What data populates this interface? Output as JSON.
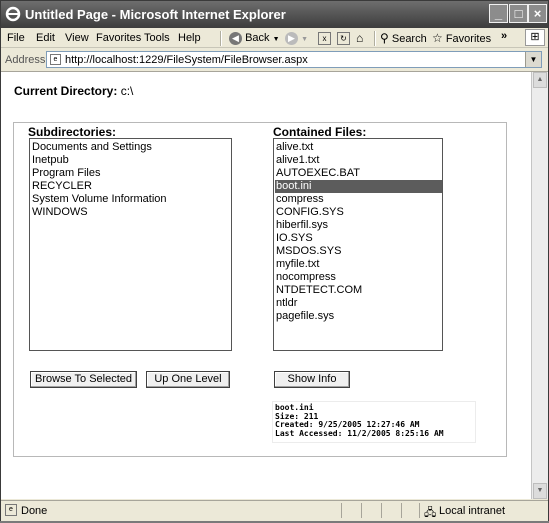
{
  "window": {
    "title": "Untitled Page - Microsoft Internet Explorer"
  },
  "menu": [
    "File",
    "Edit",
    "View",
    "Favorites",
    "Tools",
    "Help"
  ],
  "toolbar": {
    "back_label": "Back",
    "search_label": "Search",
    "favorites_label": "Favorites",
    "chevron": "»"
  },
  "address": {
    "label": "Address",
    "url": "http://localhost:1229/FileSystem/FileBrowser.aspx"
  },
  "page": {
    "current_dir_label": "Current Directory:",
    "current_dir_value": "c:\\",
    "subdirs_heading": "Subdirectories:",
    "files_heading": "Contained Files:",
    "subdirectories": [
      "Documents and Settings",
      "Inetpub",
      "Program Files",
      "RECYCLER",
      "System Volume Information",
      "WINDOWS"
    ],
    "files": [
      "alive.txt",
      "alive1.txt",
      "AUTOEXEC.BAT",
      "boot.ini",
      "compress",
      "CONFIG.SYS",
      "hiberfil.sys",
      "IO.SYS",
      "MSDOS.SYS",
      "myfile.txt",
      "nocompress",
      "NTDETECT.COM",
      "ntldr",
      "pagefile.sys"
    ],
    "selected_file": "boot.ini",
    "browse_button": "Browse To Selected",
    "up_button": "Up One Level",
    "info_button": "Show Info",
    "info_lines": [
      "boot.ini",
      "Size: 211",
      "Created: 9/25/2005 12:27:46 AM",
      "Last Accessed: 11/2/2005 8:25:16 AM"
    ]
  },
  "status": {
    "left": "Done",
    "zone": "Local intranet"
  }
}
